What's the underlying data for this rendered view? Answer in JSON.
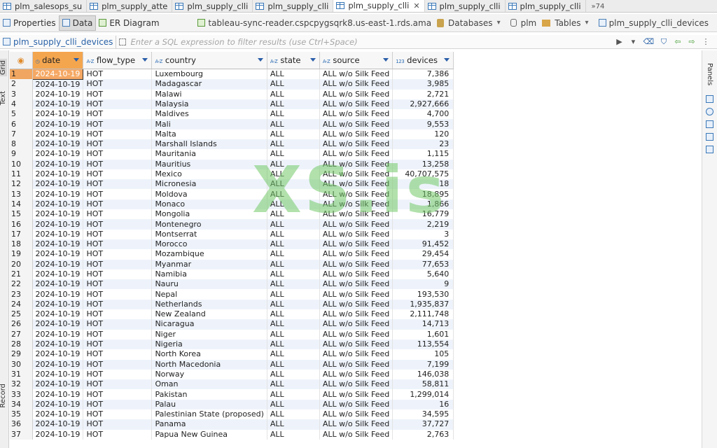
{
  "tabs": [
    {
      "label": "plm_salesops_su",
      "active": false
    },
    {
      "label": "plm_supply_atte",
      "active": false
    },
    {
      "label": "plm_supply_clli",
      "active": false
    },
    {
      "label": "plm_supply_clli",
      "active": false
    },
    {
      "label": "plm_supply_clli",
      "active": true
    },
    {
      "label": "plm_supply_clli",
      "active": false
    },
    {
      "label": "plm_supply_clli",
      "active": false
    }
  ],
  "tabs_overflow": "»74",
  "toolbar": {
    "properties": "Properties",
    "data": "Data",
    "er_diagram": "ER Diagram",
    "connection": "tableau-sync-reader.cspcpygsqrk8.us-east-1.rds.ama",
    "databases": "Databases",
    "schema": "plm",
    "tables": "Tables",
    "table_name": "plm_supply_clli_devices"
  },
  "filter": {
    "table_name": "plm_supply_clli_devices",
    "placeholder": "Enter a SQL expression to filter results (use Ctrl+Space)"
  },
  "side_panels": {
    "grid": "Grid",
    "text": "Text",
    "record": "Record",
    "panels": "Panels"
  },
  "watermark": "XS.is",
  "grid": {
    "columns": [
      {
        "name": "date",
        "type": "date"
      },
      {
        "name": "flow_type",
        "type": "A-Z"
      },
      {
        "name": "country",
        "type": "A-Z"
      },
      {
        "name": "state",
        "type": "A-Z"
      },
      {
        "name": "source",
        "type": "A-Z"
      },
      {
        "name": "devices",
        "type": "123"
      }
    ],
    "rows": [
      [
        "1",
        "2024-10-19",
        "HOT",
        "Luxembourg",
        "ALL",
        "ALL w/o Silk Feed",
        "7,386"
      ],
      [
        "2",
        "2024-10-19",
        "HOT",
        "Madagascar",
        "ALL",
        "ALL w/o Silk Feed",
        "3,985"
      ],
      [
        "3",
        "2024-10-19",
        "HOT",
        "Malawi",
        "ALL",
        "ALL w/o Silk Feed",
        "2,721"
      ],
      [
        "4",
        "2024-10-19",
        "HOT",
        "Malaysia",
        "ALL",
        "ALL w/o Silk Feed",
        "2,927,666"
      ],
      [
        "5",
        "2024-10-19",
        "HOT",
        "Maldives",
        "ALL",
        "ALL w/o Silk Feed",
        "4,700"
      ],
      [
        "6",
        "2024-10-19",
        "HOT",
        "Mali",
        "ALL",
        "ALL w/o Silk Feed",
        "9,553"
      ],
      [
        "7",
        "2024-10-19",
        "HOT",
        "Malta",
        "ALL",
        "ALL w/o Silk Feed",
        "120"
      ],
      [
        "8",
        "2024-10-19",
        "HOT",
        "Marshall Islands",
        "ALL",
        "ALL w/o Silk Feed",
        "23"
      ],
      [
        "9",
        "2024-10-19",
        "HOT",
        "Mauritania",
        "ALL",
        "ALL w/o Silk Feed",
        "1,115"
      ],
      [
        "10",
        "2024-10-19",
        "HOT",
        "Mauritius",
        "ALL",
        "ALL w/o Silk Feed",
        "13,258"
      ],
      [
        "11",
        "2024-10-19",
        "HOT",
        "Mexico",
        "ALL",
        "ALL w/o Silk Feed",
        "40,707,575"
      ],
      [
        "12",
        "2024-10-19",
        "HOT",
        "Micronesia",
        "ALL",
        "ALL w/o Silk Feed",
        "18"
      ],
      [
        "13",
        "2024-10-19",
        "HOT",
        "Moldova",
        "ALL",
        "ALL w/o Silk Feed",
        "18,895"
      ],
      [
        "14",
        "2024-10-19",
        "HOT",
        "Monaco",
        "ALL",
        "ALL w/o Silk Feed",
        "1,866"
      ],
      [
        "15",
        "2024-10-19",
        "HOT",
        "Mongolia",
        "ALL",
        "ALL w/o Silk Feed",
        "16,779"
      ],
      [
        "16",
        "2024-10-19",
        "HOT",
        "Montenegro",
        "ALL",
        "ALL w/o Silk Feed",
        "2,219"
      ],
      [
        "17",
        "2024-10-19",
        "HOT",
        "Montserrat",
        "ALL",
        "ALL w/o Silk Feed",
        "3"
      ],
      [
        "18",
        "2024-10-19",
        "HOT",
        "Morocco",
        "ALL",
        "ALL w/o Silk Feed",
        "91,452"
      ],
      [
        "19",
        "2024-10-19",
        "HOT",
        "Mozambique",
        "ALL",
        "ALL w/o Silk Feed",
        "29,454"
      ],
      [
        "20",
        "2024-10-19",
        "HOT",
        "Myanmar",
        "ALL",
        "ALL w/o Silk Feed",
        "77,653"
      ],
      [
        "21",
        "2024-10-19",
        "HOT",
        "Namibia",
        "ALL",
        "ALL w/o Silk Feed",
        "5,640"
      ],
      [
        "22",
        "2024-10-19",
        "HOT",
        "Nauru",
        "ALL",
        "ALL w/o Silk Feed",
        "9"
      ],
      [
        "23",
        "2024-10-19",
        "HOT",
        "Nepal",
        "ALL",
        "ALL w/o Silk Feed",
        "193,530"
      ],
      [
        "24",
        "2024-10-19",
        "HOT",
        "Netherlands",
        "ALL",
        "ALL w/o Silk Feed",
        "1,935,837"
      ],
      [
        "25",
        "2024-10-19",
        "HOT",
        "New Zealand",
        "ALL",
        "ALL w/o Silk Feed",
        "2,111,748"
      ],
      [
        "26",
        "2024-10-19",
        "HOT",
        "Nicaragua",
        "ALL",
        "ALL w/o Silk Feed",
        "14,713"
      ],
      [
        "27",
        "2024-10-19",
        "HOT",
        "Niger",
        "ALL",
        "ALL w/o Silk Feed",
        "1,601"
      ],
      [
        "28",
        "2024-10-19",
        "HOT",
        "Nigeria",
        "ALL",
        "ALL w/o Silk Feed",
        "113,554"
      ],
      [
        "29",
        "2024-10-19",
        "HOT",
        "North Korea",
        "ALL",
        "ALL w/o Silk Feed",
        "105"
      ],
      [
        "30",
        "2024-10-19",
        "HOT",
        "North Macedonia",
        "ALL",
        "ALL w/o Silk Feed",
        "7,199"
      ],
      [
        "31",
        "2024-10-19",
        "HOT",
        "Norway",
        "ALL",
        "ALL w/o Silk Feed",
        "146,038"
      ],
      [
        "32",
        "2024-10-19",
        "HOT",
        "Oman",
        "ALL",
        "ALL w/o Silk Feed",
        "58,811"
      ],
      [
        "33",
        "2024-10-19",
        "HOT",
        "Pakistan",
        "ALL",
        "ALL w/o Silk Feed",
        "1,299,014"
      ],
      [
        "34",
        "2024-10-19",
        "HOT",
        "Palau",
        "ALL",
        "ALL w/o Silk Feed",
        "16"
      ],
      [
        "35",
        "2024-10-19",
        "HOT",
        "Palestinian State (proposed)",
        "ALL",
        "ALL w/o Silk Feed",
        "34,595"
      ],
      [
        "36",
        "2024-10-19",
        "HOT",
        "Panama",
        "ALL",
        "ALL w/o Silk Feed",
        "37,727"
      ],
      [
        "37",
        "2024-10-19",
        "HOT",
        "Papua New Guinea",
        "ALL",
        "ALL w/o Silk Feed",
        "2,763"
      ]
    ],
    "selected_row": "1"
  }
}
